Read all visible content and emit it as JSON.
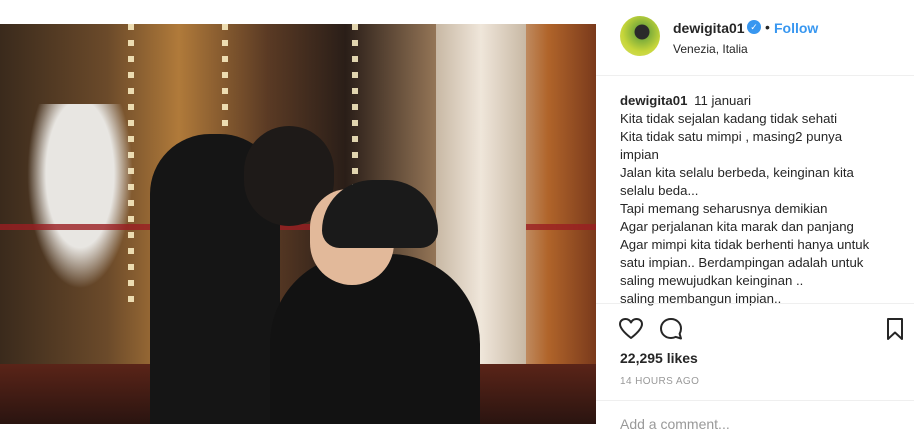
{
  "post": {
    "username": "dewigita01",
    "follow_label": "Follow",
    "location": "Venezia, Italia",
    "caption_date": "11 januari",
    "caption_lines": [
      "Kita tidak sejalan kadang tidak sehati",
      "Kita tidak satu mimpi , masing2 punya",
      "impian",
      "Jalan kita selalu berbeda, keinginan kita",
      "selalu beda...",
      "Tapi memang seharusnya demikian",
      "Agar perjalanan kita marak dan panjang",
      "Agar mimpi kita tidak berhenti hanya untuk",
      "satu impian.. Berdampingan adalah untuk",
      "saling mewujudkan keinginan ..",
      "saling membangun impian.."
    ],
    "likes": "22,295 likes",
    "time": "14 HOURS AGO",
    "comment_placeholder": "Add a comment..."
  },
  "colors": {
    "accent": "#3897f0",
    "text": "#262626",
    "muted": "#999999",
    "divider": "#efefef"
  },
  "icons": {
    "verified": "verified-badge-icon",
    "like": "heart-icon",
    "comment": "comment-bubble-icon",
    "save": "bookmark-icon"
  }
}
